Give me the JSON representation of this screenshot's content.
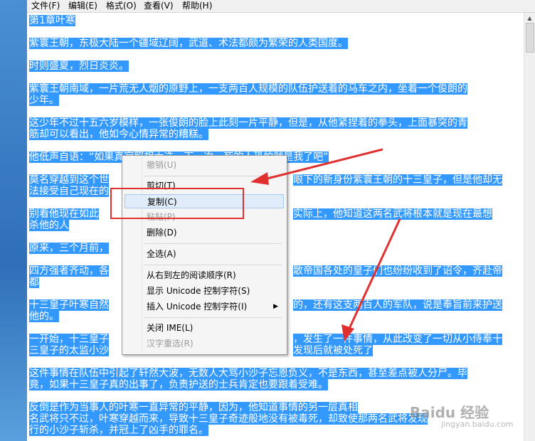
{
  "menubar": [
    "文件(F)",
    "编辑(E)",
    "格式(O)",
    "查看(V)",
    "帮助(H)"
  ],
  "lines": [
    "第1章叶寒",
    "紫寰王朝，东极大陆一个疆域辽阔，武道、术法都颇为繁荣的人类国度。",
    "时则盛夏，烈日炎炎。",
    "紫寰王朝南域，一片荒无人烟的原野上，一支两百人规模的队伍护送着的马车之内，坐着一个俊朗的",
    "少年。",
    "这少年不过十五六岁模样，一张俊朗的脸上此刻一片平静，但是，从他紧捏着的拳头，上面暴突的青",
    "筋却可以看出，他如今心情异常的糟糕。",
    "他低声自语：“如果真寂照相大选一下一次，死的人恐怕就是我了吧”",
    "莫名穿越到这个世",
    "法接受自己现在的",
    "别看他现在如此",
    "杀他的人",
    "原来，三个月前，",
    "四方强者齐动，各",
    "都",
    "十三皇子叶寒自然",
    "他的。",
    "一开始，十三皇子",
    "三皇子的太监小沙",
    "这件事情在队伍中引起了轩然大波，无数人大骂小沙子忘恩负义，不是东西，甚至差点被人分尸。毕",
    "竟，如果十三皇子真的出事了，负责护送的士兵肯定也要跟着受难。",
    "反倒是作为当事人的叶寒一直异常的平静，因为，他知道事情的另一层真相",
    "名武将只不过，叶寒穿越而来，导致十三皇子奇迹般地没有被毒死，却致使那两名武将发现",
    "行的小沙子斩杀，并冠上了凶手的罪名。"
  ],
  "line_tails": {
    "8": "眼下的新身份紫寰王朝的十三皇子，但是他却无",
    "10": "实际上，他知道这两名武将根本就是现在最想",
    "13": "散帝国各处的皇子们也纷纷收到了诏令，齐赴帝",
    "15": "的，还有这支两百人的军队，说是奉旨前来护送",
    "17": "，发生了一件事情，从此改变了一切从小侍奉十",
    "18": "发现后就被处死了"
  },
  "context_menu": {
    "items": [
      {
        "label": "撤销(U)",
        "disabled": true
      },
      {
        "label": "剪切(T)",
        "disabled": false
      },
      {
        "label": "复制(C)",
        "disabled": false,
        "highlighted": true
      },
      {
        "label": "粘贴(P)",
        "disabled": true
      },
      {
        "label": "删除(D)",
        "disabled": false
      },
      {
        "label": "全选(A)",
        "disabled": false
      },
      {
        "label": "从右到左的阅读顺序(R)",
        "disabled": false
      },
      {
        "label": "显示 Unicode 控制字符(S)",
        "disabled": false
      },
      {
        "label": "插入 Unicode 控制字符(I)",
        "disabled": false,
        "submenu": true
      },
      {
        "label": "关闭 IME(L)",
        "disabled": false
      },
      {
        "label": "汉字重选(R)",
        "disabled": true
      }
    ]
  },
  "watermark": {
    "brand": "Baidu 经验",
    "url": "jingyan.baidu.com"
  },
  "colors": {
    "selection": "#3399ff",
    "annotation": "#e03030"
  }
}
